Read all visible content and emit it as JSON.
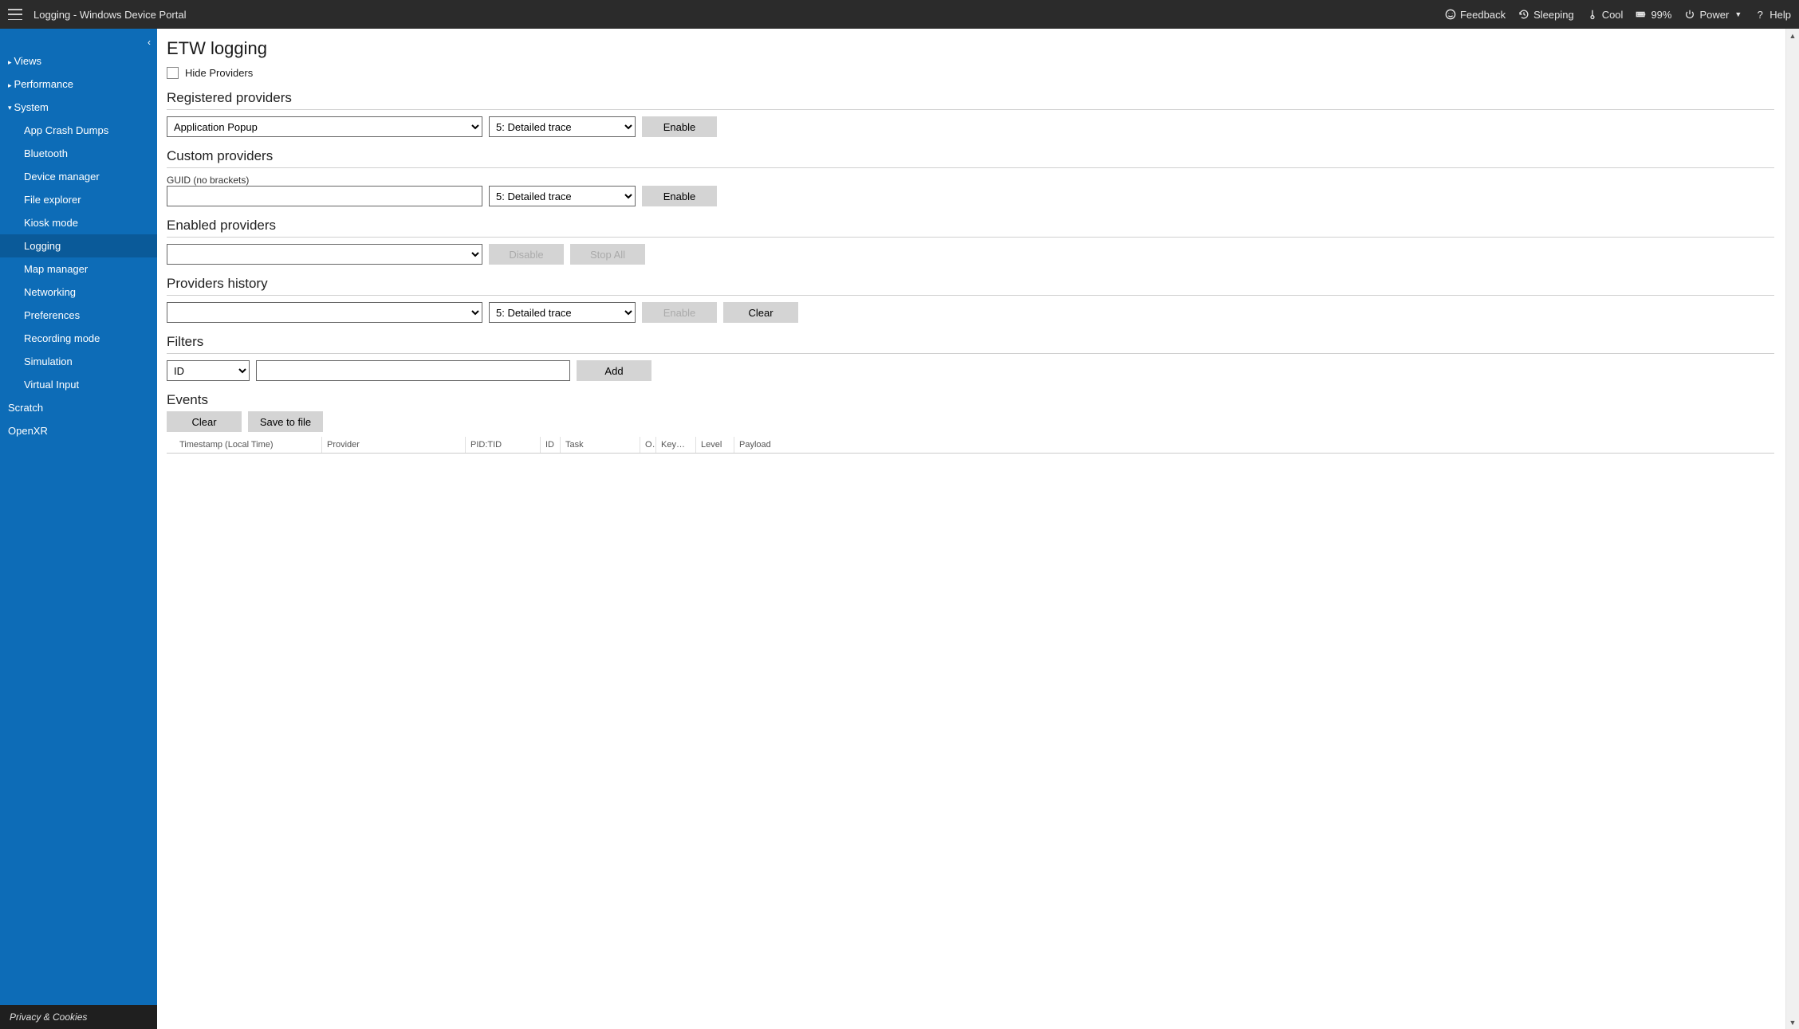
{
  "topbar": {
    "title": "Logging - Windows Device Portal",
    "feedback": "Feedback",
    "sleep": "Sleeping",
    "temp": "Cool",
    "battery": "99%",
    "power": "Power",
    "help": "Help"
  },
  "sidebar": {
    "groups": {
      "views": "Views",
      "performance": "Performance",
      "system": "System"
    },
    "system_items": [
      "App Crash Dumps",
      "Bluetooth",
      "Device manager",
      "File explorer",
      "Kiosk mode",
      "Logging",
      "Map manager",
      "Networking",
      "Preferences",
      "Recording mode",
      "Simulation",
      "Virtual Input"
    ],
    "extra": {
      "scratch": "Scratch",
      "openxr": "OpenXR"
    },
    "footer": "Privacy & Cookies"
  },
  "page": {
    "title": "ETW logging",
    "hide_providers": "Hide Providers",
    "registered": {
      "heading": "Registered providers",
      "provider_selected": "Application Popup",
      "level_selected": "5: Detailed trace",
      "enable": "Enable"
    },
    "custom": {
      "heading": "Custom providers",
      "guid_label": "GUID (no brackets)",
      "level_selected": "5: Detailed trace",
      "enable": "Enable"
    },
    "enabled": {
      "heading": "Enabled providers",
      "disable": "Disable",
      "stopall": "Stop All"
    },
    "history": {
      "heading": "Providers history",
      "level_selected": "5: Detailed trace",
      "enable": "Enable",
      "clear": "Clear"
    },
    "filters": {
      "heading": "Filters",
      "type_selected": "ID",
      "add": "Add"
    },
    "events": {
      "heading": "Events",
      "clear": "Clear",
      "save": "Save to file",
      "cols": {
        "ts": "Timestamp (Local Time)",
        "prov": "Provider",
        "pt": "PID:TID",
        "id": "ID",
        "task": "Task",
        "op": "O...",
        "kw": "Keyword",
        "lv": "Level",
        "pl": "Payload"
      }
    }
  }
}
